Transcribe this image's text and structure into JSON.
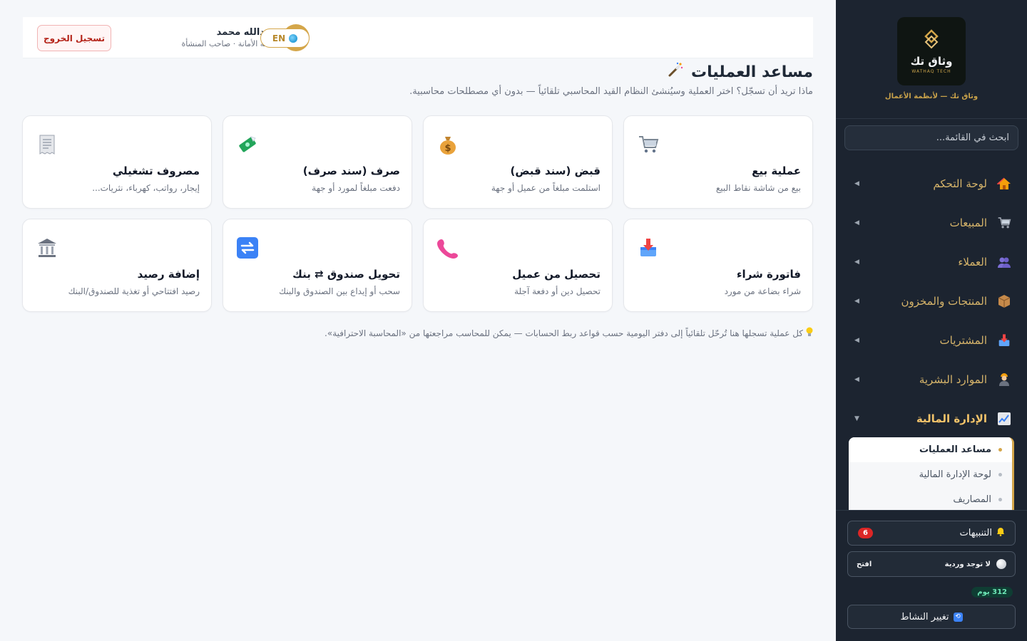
{
  "sidebar": {
    "logo_text": "وثاق تك",
    "logo_subtext": "WATHAQ TECH",
    "tagline": "وثاق تك — لأنظمة الأعمال",
    "search_placeholder": "ابحث في القائمة...",
    "menu": [
      {
        "label": "لوحة التحكم",
        "icon": "house-icon"
      },
      {
        "label": "المبيعات",
        "icon": "cart-icon"
      },
      {
        "label": "العملاء",
        "icon": "users-icon"
      },
      {
        "label": "المنتجات والمخزون",
        "icon": "package-icon"
      },
      {
        "label": "المشتريات",
        "icon": "inbox-icon"
      },
      {
        "label": "الموارد البشرية",
        "icon": "worker-icon"
      },
      {
        "label": "الإدارة المالية",
        "icon": "chart-icon",
        "active": true
      }
    ],
    "submenu": [
      {
        "label": "مساعد العمليات",
        "active": true
      },
      {
        "label": "لوحة الإدارة المالية"
      },
      {
        "label": "المصاريف"
      }
    ],
    "notifications": {
      "label": "التنبيهات",
      "count": "6"
    },
    "shift": {
      "status": "لا توجد وردية",
      "open_label": "افتح"
    },
    "days_badge": "312 يوم",
    "change_activity": "تغيير النشاط"
  },
  "header": {
    "user_name": "عبدالله محمد",
    "user_role": "بقالة الأمانة · صاحب المنشأة",
    "avatar_initial": "ع",
    "lang": "EN",
    "logout": "تسجيل الخروج"
  },
  "page": {
    "title": "مساعد العمليات",
    "subtitle": "ماذا تريد أن تسجّل؟ اختر العملية وسيُنشئ النظام القيد المحاسبي تلقائياً — بدون أي مصطلحات محاسبية.",
    "footnote": "كل عملية تسجلها هنا تُرحّل تلقائياً إلى دفتر اليومية حسب قواعد ربط الحسابات — يمكن للمحاسب مراجعتها من «المحاسبة الاحترافية»."
  },
  "cards": [
    {
      "title": "عملية بيع",
      "desc": "بيع من شاشة نقاط البيع",
      "icon": "cart-icon"
    },
    {
      "title": "قبض (سند قبض)",
      "desc": "استلمت مبلغاً من عميل أو جهة",
      "icon": "money-bag-icon"
    },
    {
      "title": "صرف (سند صرف)",
      "desc": "دفعت مبلغاً لمورد أو جهة",
      "icon": "money-wings-icon"
    },
    {
      "title": "مصروف تشغيلي",
      "desc": "إيجار، رواتب، كهرباء، نثريات...",
      "icon": "receipt-icon"
    },
    {
      "title": "فاتورة شراء",
      "desc": "شراء بضاعة من مورد",
      "icon": "inbox-tray-icon"
    },
    {
      "title": "تحصيل من عميل",
      "desc": "تحصيل دين أو دفعة آجلة",
      "icon": "phone-icon"
    },
    {
      "title": "تحويل صندوق ⇄ بنك",
      "desc": "سحب أو إيداع بين الصندوق والبنك",
      "icon": "transfer-icon"
    },
    {
      "title": "إضافة رصيد",
      "desc": "رصيد افتتاحي أو تغذية للصندوق/البنك",
      "icon": "bank-icon"
    }
  ]
}
